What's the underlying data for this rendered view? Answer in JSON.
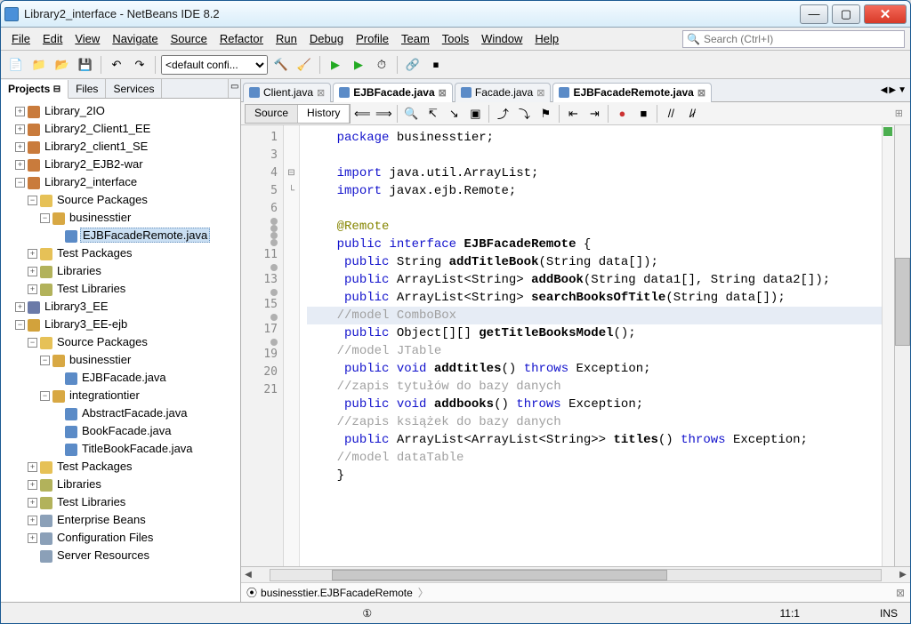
{
  "window": {
    "title": "Library2_interface - NetBeans IDE 8.2"
  },
  "menu": [
    "File",
    "Edit",
    "View",
    "Navigate",
    "Source",
    "Refactor",
    "Run",
    "Debug",
    "Profile",
    "Team",
    "Tools",
    "Window",
    "Help"
  ],
  "search": {
    "placeholder": "Search (Ctrl+I)"
  },
  "toolbar": {
    "config": "<default confi..."
  },
  "left_tabs": {
    "projects": "Projects",
    "files": "Files",
    "services": "Services"
  },
  "tree": {
    "n0": "Library_2IO",
    "n1": "Library2_Client1_EE",
    "n2": "Library2_client1_SE",
    "n3": "Library2_EJB2-war",
    "n4": "Library2_interface",
    "n4_0": "Source Packages",
    "n4_0_0": "businesstier",
    "n4_0_0_0": "EJBFacadeRemote.java",
    "n4_1": "Test Packages",
    "n4_2": "Libraries",
    "n4_3": "Test Libraries",
    "n5": "Library3_EE",
    "n6": "Library3_EE-ejb",
    "n6_0": "Source Packages",
    "n6_0_0": "businesstier",
    "n6_0_0_0": "EJBFacade.java",
    "n6_0_1": "integrationtier",
    "n6_0_1_0": "AbstractFacade.java",
    "n6_0_1_1": "BookFacade.java",
    "n6_0_1_2": "TitleBookFacade.java",
    "n6_1": "Test Packages",
    "n6_2": "Libraries",
    "n6_3": "Test Libraries",
    "n6_4": "Enterprise Beans",
    "n6_5": "Configuration Files",
    "n6_6": "Server Resources"
  },
  "file_tabs": [
    {
      "label": "Client.java",
      "active": false
    },
    {
      "label": "EJBFacade.java",
      "active": true
    },
    {
      "label": "Facade.java",
      "active": false
    },
    {
      "label": "EJBFacadeRemote.java",
      "active": true
    }
  ],
  "editor_tabs": {
    "source": "Source",
    "history": "History"
  },
  "gutter_lines": [
    "1",
    "",
    "3",
    "4",
    "5",
    "6",
    "",
    "",
    "",
    "",
    "11",
    "",
    "13",
    "",
    "15",
    "",
    "17",
    "",
    "19",
    "20",
    "21"
  ],
  "code_lines": [
    {
      "t": "kw",
      "pre": "    ",
      "a": "package",
      "b": " businesstier;"
    },
    {
      "t": "",
      "pre": "",
      "a": "",
      "b": ""
    },
    {
      "t": "kw",
      "pre": "    ",
      "a": "import",
      "b": " java.util.ArrayList;"
    },
    {
      "t": "kw",
      "pre": "    ",
      "a": "import",
      "b": " javax.ejb.Remote;"
    },
    {
      "t": "",
      "pre": "",
      "a": "",
      "b": ""
    },
    {
      "t": "an",
      "pre": "    ",
      "a": "@Remote",
      "b": ""
    },
    {
      "t": "sig",
      "pre": "    ",
      "raw": "<span class='kw'>public</span> <span class='kw'>interface</span> <span class='id'>EJBFacadeRemote</span> {"
    },
    {
      "t": "sig",
      "pre": "     ",
      "raw": "<span class='kw'>public</span> String <span class='id'>addTitleBook</span>(String data[]);"
    },
    {
      "t": "sig",
      "pre": "     ",
      "raw": "<span class='kw'>public</span> ArrayList&lt;String&gt; <span class='id'>addBook</span>(String data1[], String data2[]);"
    },
    {
      "t": "sig",
      "pre": "     ",
      "raw": "<span class='kw'>public</span> ArrayList&lt;String&gt; <span class='id'>searchBooksOfTitle</span>(String data[]);"
    },
    {
      "t": "hlcm",
      "pre": "    ",
      "a": "//model ComboBox",
      "b": ""
    },
    {
      "t": "sig",
      "pre": "     ",
      "raw": "<span class='kw'>public</span> Object[][] <span class='id'>getTitleBooksModel</span>();"
    },
    {
      "t": "cm",
      "pre": "    ",
      "a": "//model JTable",
      "b": ""
    },
    {
      "t": "sig",
      "pre": "     ",
      "raw": "<span class='kw'>public</span> <span class='kw'>void</span> <span class='id'>addtitles</span>() <span class='kw'>throws</span> Exception;"
    },
    {
      "t": "cm",
      "pre": "    ",
      "a": "//zapis tytułów do bazy danych",
      "b": ""
    },
    {
      "t": "sig",
      "pre": "     ",
      "raw": "<span class='kw'>public</span> <span class='kw'>void</span> <span class='id'>addbooks</span>() <span class='kw'>throws</span> Exception;"
    },
    {
      "t": "cm",
      "pre": "    ",
      "a": "//zapis książek do bazy danych",
      "b": ""
    },
    {
      "t": "sig",
      "pre": "     ",
      "raw": "<span class='kw'>public</span> ArrayList&lt;ArrayList&lt;String&gt;&gt; <span class='id'>titles</span>() <span class='kw'>throws</span> Exception;"
    },
    {
      "t": "cm",
      "pre": "    ",
      "a": "//model dataTable",
      "b": ""
    },
    {
      "t": "",
      "pre": "    ",
      "a": "}",
      "b": ""
    },
    {
      "t": "",
      "pre": "",
      "a": "",
      "b": ""
    }
  ],
  "breadcrumb": {
    "seg1": "businesstier.EJBFacadeRemote"
  },
  "status": {
    "pos": "11:1",
    "mode": "INS"
  }
}
